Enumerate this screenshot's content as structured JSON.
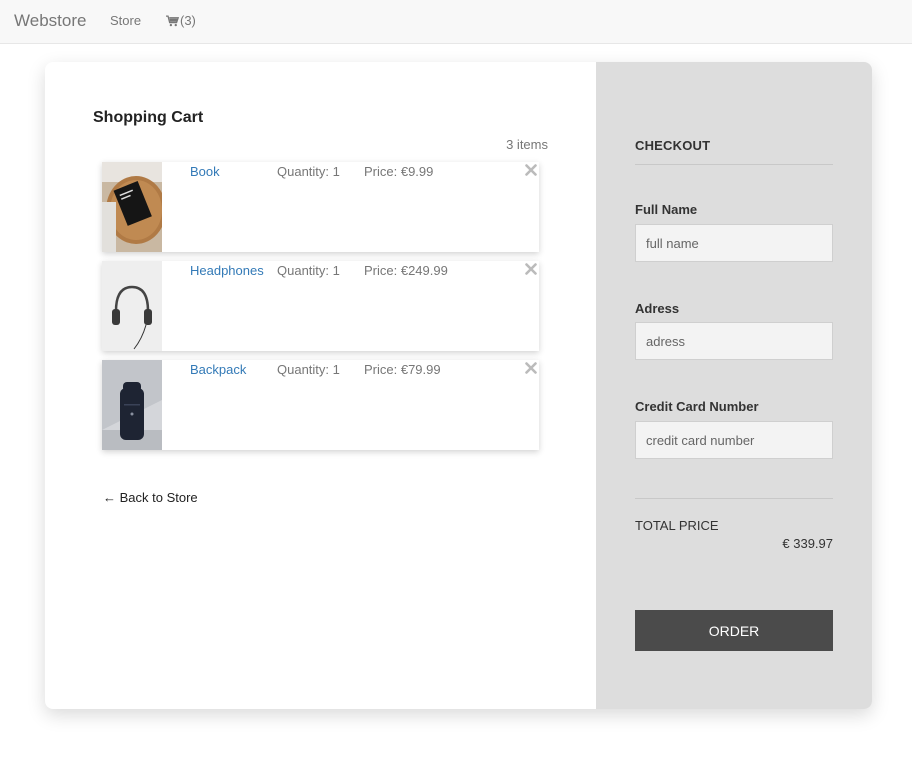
{
  "navbar": {
    "brand": "Webstore",
    "store_link": "Store",
    "cart_count": "(3)",
    "cart_icon": "shopping-cart-icon"
  },
  "cart": {
    "title": "Shopping Cart",
    "count_label": "3 items",
    "items": [
      {
        "name": "Book",
        "quantity": "Quantity: 1",
        "price": "Price: €9.99",
        "image": "book-photo"
      },
      {
        "name": "Headphones",
        "quantity": "Quantity: 1",
        "price": "Price: €249.99",
        "image": "headphones-photo"
      },
      {
        "name": "Backpack",
        "quantity": "Quantity: 1",
        "price": "Price: €79.99",
        "image": "backpack-photo"
      }
    ],
    "remove_icon": "close-icon",
    "back_link": "← Back to Store"
  },
  "checkout": {
    "title": "CHECKOUT",
    "full_name_label": "Full Name",
    "full_name_placeholder": "full name",
    "address_label": "Adress",
    "address_placeholder": "adress",
    "card_label": "Credit Card Number",
    "card_placeholder": "credit card number",
    "total_label": "TOTAL PRICE",
    "total_value": "€ 339.97",
    "order_button": "ORDER"
  },
  "colors": {
    "link": "#337ab7",
    "checkout_bg": "#dddddd",
    "order_button": "#4b4b4b"
  }
}
